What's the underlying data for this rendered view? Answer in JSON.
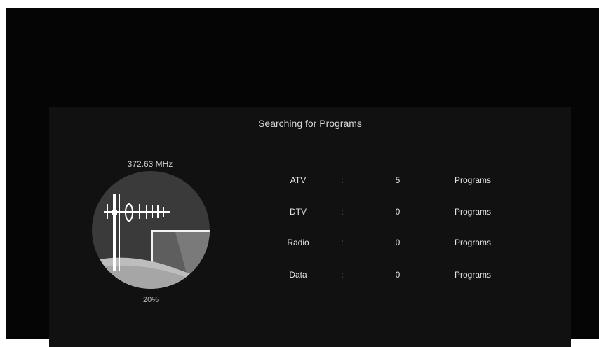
{
  "title": "Searching for Programs",
  "frequency": "372.63 MHz",
  "progress": {
    "label": "20%",
    "value": 0.2
  },
  "rows": [
    {
      "label": "ATV",
      "separator": ":",
      "count": "5",
      "unit": "Programs"
    },
    {
      "label": "DTV",
      "separator": ":",
      "count": "0",
      "unit": "Programs"
    },
    {
      "label": "Radio",
      "separator": ":",
      "count": "0",
      "unit": "Programs"
    },
    {
      "label": "Data",
      "separator": ":",
      "count": "0",
      "unit": "Programs"
    }
  ],
  "icons": {
    "dial": "antenna-tv-icon"
  },
  "colors": {
    "background": "#050505",
    "panel": "#111111",
    "text": "#e6e6e6"
  }
}
